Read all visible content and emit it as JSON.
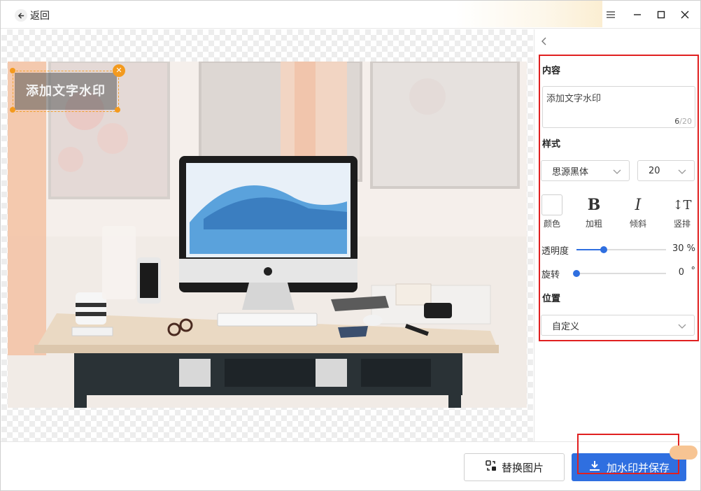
{
  "titlebar": {
    "back_label": "返回"
  },
  "watermark": {
    "text": "添加文字水印"
  },
  "panel": {
    "content_title": "内容",
    "content_value": "添加文字水印",
    "char_count": "6",
    "char_max": "/20",
    "style_title": "样式",
    "font_family": "思源黑体",
    "font_size": "20",
    "style_buttons": {
      "color": "颜色",
      "bold": "加粗",
      "italic": "倾斜",
      "vertical": "竖排"
    },
    "opacity_label": "透明度",
    "opacity_value": "30 %",
    "opacity_fraction": 0.3,
    "rotate_label": "旋转",
    "rotate_value": "0",
    "rotate_unit": "°",
    "position_title": "位置",
    "position_value": "自定义"
  },
  "bottombar": {
    "replace_label": "替换图片",
    "save_label": "加水印并保存"
  },
  "colors": {
    "accent": "#2f6fe0",
    "highlight": "#e02020",
    "handle": "#f39a1e"
  }
}
